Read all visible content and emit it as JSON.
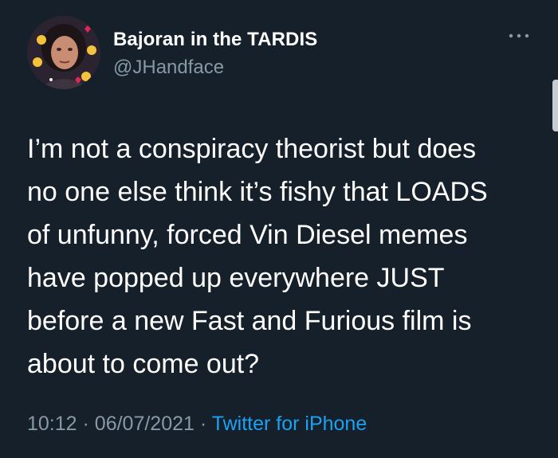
{
  "author": {
    "display_name": "Bajoran in the TARDIS",
    "handle": "@JHandface"
  },
  "more_menu_icon": "ellipsis-icon",
  "tweet": {
    "lines": [
      "I’m not a conspiracy theorist but does",
      "no one else think it’s fishy that LOADS",
      "of unfunny, forced Vin Diesel memes",
      "have popped up everywhere JUST",
      "before a new Fast and Furious film is",
      "about to come out?"
    ]
  },
  "meta": {
    "time": "10:12",
    "separator": "·",
    "date": "06/07/2021",
    "source": "Twitter for iPhone"
  },
  "colors": {
    "background": "#15202b",
    "text": "#ffffff",
    "secondary_text": "#8899a6",
    "link": "#1da1f2"
  }
}
